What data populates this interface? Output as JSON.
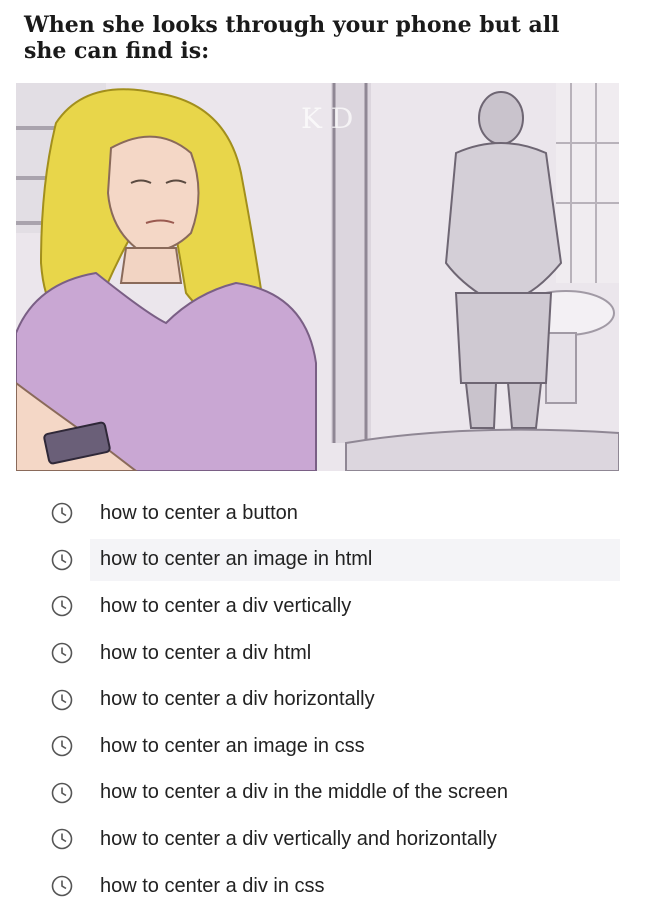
{
  "caption": {
    "line1": "When she looks through your phone but all",
    "line2": "she can find is:"
  },
  "image": {
    "watermark": "K D",
    "description_icon": "comic-illustration"
  },
  "history": {
    "icon": "clock-icon",
    "items": [
      {
        "label": "how to center a button"
      },
      {
        "label": "how to center an image in html"
      },
      {
        "label": "how to center a div vertically"
      },
      {
        "label": "how to center a div html"
      },
      {
        "label": "how to center a div horizontally"
      },
      {
        "label": "how to center an image in css"
      },
      {
        "label": "how to center a div in the middle of the screen"
      },
      {
        "label": "how to center a div vertically and horizontally"
      },
      {
        "label": "how to center a div in css"
      }
    ]
  },
  "colors": {
    "text": "#222222",
    "icon": "#555555",
    "highlight": "#f4f4f7"
  }
}
